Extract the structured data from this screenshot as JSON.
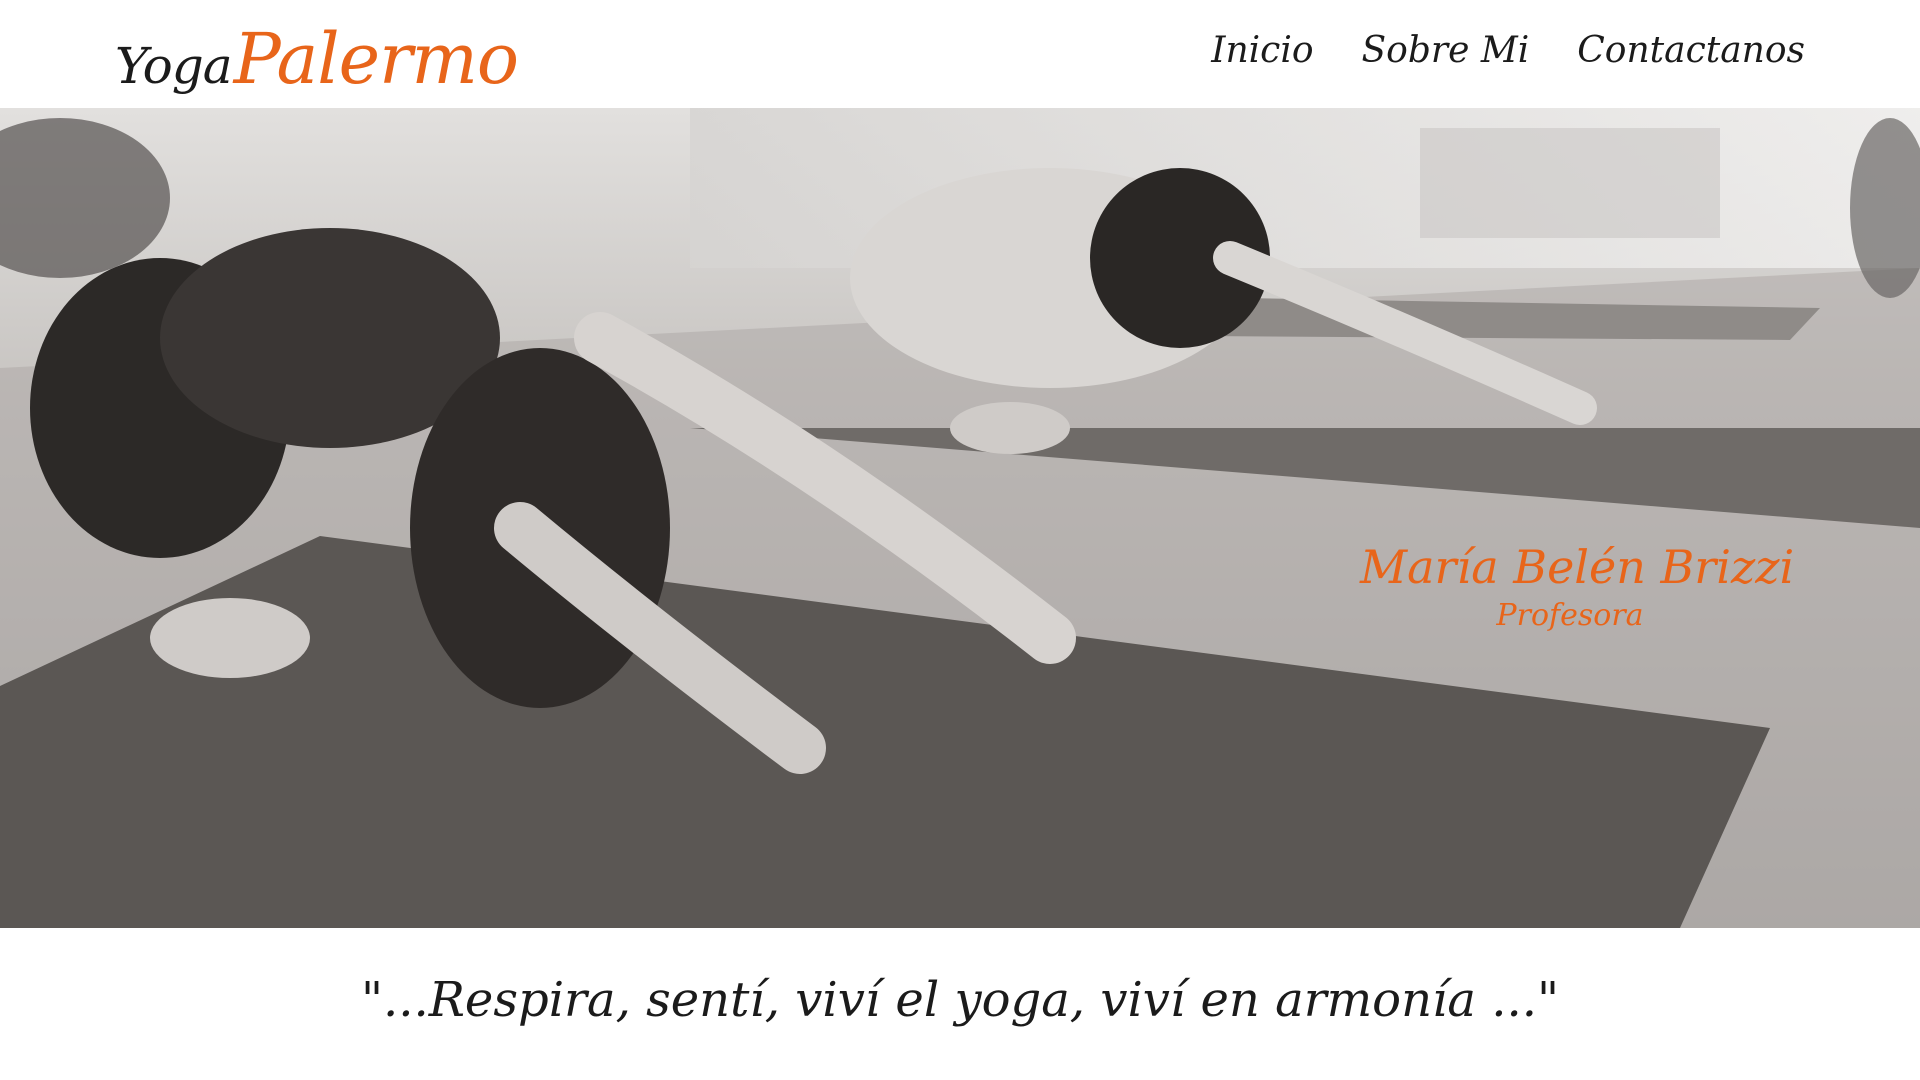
{
  "brand": {
    "yoga": "Yoga",
    "palermo": "Palermo"
  },
  "nav": {
    "items": [
      {
        "label": "Inicio"
      },
      {
        "label": "Sobre Mi"
      },
      {
        "label": "Contactanos"
      }
    ]
  },
  "hero": {
    "teacher_name": "María Belén Brizzi",
    "teacher_role": "Profesora"
  },
  "quote": "\"...Respira, sentí, viví el yoga, viví en armonía ...\"",
  "colors": {
    "accent": "#e8651a",
    "text": "#1b1b1b",
    "background": "#ffffff"
  }
}
